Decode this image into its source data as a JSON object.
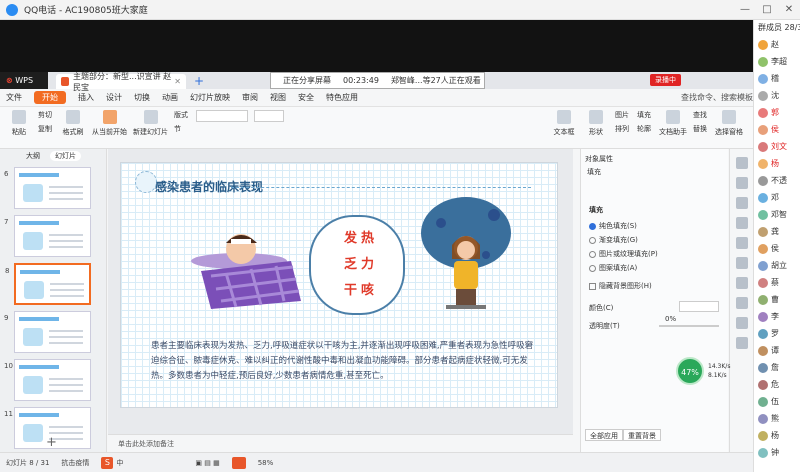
{
  "qq": {
    "title": "QQ电话 - AC190805班大家庭",
    "window_buttons": [
      "—",
      "□",
      "✕"
    ],
    "member_header": "群成员 28/3",
    "members": [
      {
        "name": "赵",
        "color": "#333",
        "av": "#f0a33a"
      },
      {
        "name": "李超",
        "color": "#333",
        "av": "#8fc26a"
      },
      {
        "name": "稽",
        "color": "#333",
        "av": "#7fb0e4"
      },
      {
        "name": "沈",
        "color": "#333",
        "av": "#aaa"
      },
      {
        "name": "郭",
        "color": "#e02424",
        "av": "#e87a7a"
      },
      {
        "name": "侯",
        "color": "#e02424",
        "av": "#e8a07a"
      },
      {
        "name": "刘文",
        "color": "#e02424",
        "av": "#d9797a"
      },
      {
        "name": "杨",
        "color": "#e02424",
        "av": "#f0b36a"
      },
      {
        "name": "不透",
        "color": "#333",
        "av": "#999"
      },
      {
        "name": "邓",
        "color": "#333",
        "av": "#6ab0e0"
      },
      {
        "name": "邓智",
        "color": "#333",
        "av": "#70c0a0"
      },
      {
        "name": "龚",
        "color": "#333",
        "av": "#c0a070"
      },
      {
        "name": "侯",
        "color": "#333",
        "av": "#e0a060"
      },
      {
        "name": "胡立",
        "color": "#333",
        "av": "#80a0d0"
      },
      {
        "name": "蔡",
        "color": "#333",
        "av": "#d08080"
      },
      {
        "name": "曹",
        "color": "#333",
        "av": "#90b070"
      },
      {
        "name": "李",
        "color": "#333",
        "av": "#a080c0"
      },
      {
        "name": "罗",
        "color": "#333",
        "av": "#60a0c0"
      },
      {
        "name": "谭",
        "color": "#333",
        "av": "#c09060"
      },
      {
        "name": "詹",
        "color": "#333",
        "av": "#7090b0"
      },
      {
        "name": "危",
        "color": "#333",
        "av": "#b07070"
      },
      {
        "name": "伍",
        "color": "#333",
        "av": "#70b090"
      },
      {
        "name": "熊",
        "color": "#333",
        "av": "#9090c0"
      },
      {
        "name": "杨",
        "color": "#333",
        "av": "#c0b060"
      },
      {
        "name": "钟",
        "color": "#333",
        "av": "#80c0c0"
      }
    ]
  },
  "wps": {
    "logo": "WPS",
    "doc_tab": "主题部分：新型...识宣讲 赵民宝",
    "share": {
      "status": "正在分享屏幕",
      "time": "00:23:49",
      "viewers": "郑智峰...等27人正在观看"
    },
    "record_label": "录播中",
    "menu": [
      "文件",
      "开始",
      "插入",
      "设计",
      "切换",
      "动画",
      "幻灯片放映",
      "审阅",
      "视图",
      "安全",
      "特色应用"
    ],
    "menu_search": "查找命令、搜索模板",
    "ribbon": {
      "paste": "粘贴",
      "cut": "剪切",
      "copy": "复制",
      "format_painter": "格式刷",
      "from_current": "从当前开始",
      "new_slide": "新建幻灯片",
      "layout": "版式",
      "section": "节",
      "textbox": "文本框",
      "shape": "形状",
      "arrange": "排列",
      "picture": "图片",
      "fill": "填充",
      "outline": "轮廓",
      "find": "查找",
      "text_tool": "文档助手",
      "replace": "替换",
      "select": "选择窗格"
    }
  },
  "thumbs": {
    "tabs": [
      "大纲",
      "幻灯片"
    ],
    "items": [
      {
        "num": "6",
        "selected": false
      },
      {
        "num": "7",
        "selected": false
      },
      {
        "num": "8",
        "selected": true
      },
      {
        "num": "9",
        "selected": false
      },
      {
        "num": "10",
        "selected": false
      },
      {
        "num": "11",
        "selected": false
      }
    ],
    "add": "+"
  },
  "slide": {
    "title": "感染患者的临床表现",
    "symptoms": [
      "发热",
      "乏力",
      "干咳"
    ],
    "body": "患者主要临床表现为发热、乏力,呼吸道症状以干咳为主,并逐渐出现呼吸困难,严重者表现为急性呼吸窘迫综合征、脓毒症休克、难以纠正的代谢性酸中毒和出凝血功能障碍。部分患者起病症状轻微,可无发热。多数患者为中轻症,预后良好,少数患者病情危重,甚至死亡。"
  },
  "notes": "单击此处添加备注",
  "props": {
    "title": "对象属性",
    "fill_tab": "填充",
    "fill_head": "填充",
    "options": [
      {
        "label": "纯色填充(S)",
        "on": true
      },
      {
        "label": "渐变填充(G)",
        "on": false
      },
      {
        "label": "图片或纹理填充(P)",
        "on": false
      },
      {
        "label": "图案填充(A)",
        "on": false
      }
    ],
    "hide_bg": "隐藏背景图形(H)",
    "color_label": "颜色(C)",
    "transparency_label": "透明度(T)",
    "transparency_value": "0%",
    "apply_all": "全部应用",
    "reset_bg": "重置背景"
  },
  "status": {
    "slide": "幻灯片 8 / 31",
    "theme": "抗击疫情",
    "ime": "中",
    "zoom": "58%",
    "net_pct": "47%",
    "up": "14.3K/s",
    "down": "8.1K/s"
  }
}
